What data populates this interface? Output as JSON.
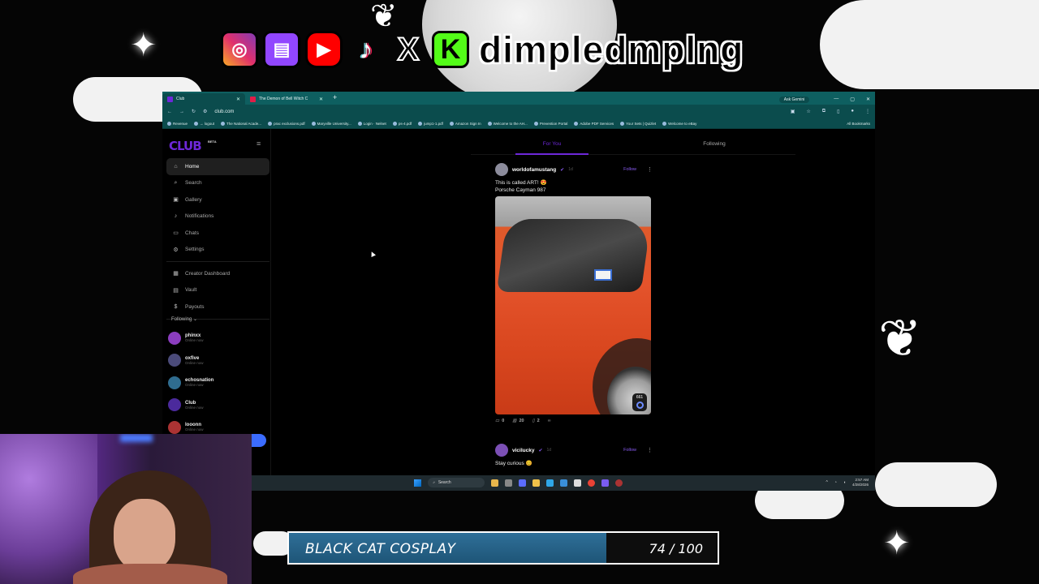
{
  "overlay": {
    "handle": "dimpledmplng",
    "socials": [
      "instagram-icon",
      "twitch-icon",
      "youtube-icon",
      "tiktok-icon",
      "x-icon",
      "kick-icon"
    ],
    "goal": {
      "title": "BLACK CAT COSPLAY",
      "count": "74 / 100",
      "current": 74,
      "target": 100
    }
  },
  "browser": {
    "tabs": [
      {
        "title": "Club",
        "active": true
      },
      {
        "title": "The Demon of Bell Witch C",
        "active": false
      }
    ],
    "new_tab": "+",
    "ask_gemini": "Ask Gemini",
    "url": "club.com",
    "bookmarks": [
      "Revenue",
      "→ logout",
      "The National Acade...",
      "prac exclusions.pdf",
      "Maryville University...",
      "Login · Nelnet",
      "ps-4.pdf",
      "jump1-1.pdf",
      "Amazon Sign In",
      "Welcome to the AH...",
      "Prevention Portal",
      "Adobe PDF Services",
      "Your Sets | Quizlet",
      "Welcome to eBay"
    ],
    "all_bookmarks": "All Bookmarks"
  },
  "app": {
    "logo": "CLUB",
    "beta": "BETA",
    "nav": [
      {
        "label": "Home",
        "icon": "home-icon",
        "glyph": "⌂",
        "active": true
      },
      {
        "label": "Search",
        "icon": "search-icon",
        "glyph": "⌕"
      },
      {
        "label": "Gallery",
        "icon": "gallery-icon",
        "glyph": "▣"
      },
      {
        "label": "Notifications",
        "icon": "bell-icon",
        "glyph": "♪"
      },
      {
        "label": "Chats",
        "icon": "chat-icon",
        "glyph": "▭"
      },
      {
        "label": "Settings",
        "icon": "gear-icon",
        "glyph": "⚙"
      }
    ],
    "nav2": [
      {
        "label": "Creator Dashboard",
        "icon": "dashboard-icon",
        "glyph": "▦"
      },
      {
        "label": "Vault",
        "icon": "vault-icon",
        "glyph": "▤"
      },
      {
        "label": "Payouts",
        "icon": "payouts-icon",
        "glyph": "$"
      }
    ],
    "following_header": "Following ⌄",
    "following": [
      {
        "name": "phinxx",
        "status": "Online now",
        "color": "#8b3dbf"
      },
      {
        "name": "oxfive",
        "status": "Online now",
        "color": "#4b4b7a"
      },
      {
        "name": "echosnation",
        "status": "Online now",
        "color": "#2f6c8f"
      },
      {
        "name": "Club",
        "status": "Online now",
        "color": "#4b2a9c"
      },
      {
        "name": "looonn",
        "status": "Online now",
        "color": "#a33"
      }
    ],
    "feed_tabs": {
      "for_you": "For You",
      "following": "Following"
    },
    "posts": [
      {
        "user": "worldofamustang",
        "ago": "1d",
        "follow": "Follow",
        "caption_1": "This is called ART! 😍",
        "caption_2": "Porsche Cayman 987",
        "media_count": "661",
        "comments": "0",
        "views": "20",
        "saves": "2"
      },
      {
        "user": "vicilucky",
        "ago": "1d",
        "follow": "Follow",
        "caption_1": "Stay curious 😊"
      }
    ]
  },
  "taskbar": {
    "search": "Search",
    "time": "2:57 AM",
    "date": "4/28/2026"
  }
}
